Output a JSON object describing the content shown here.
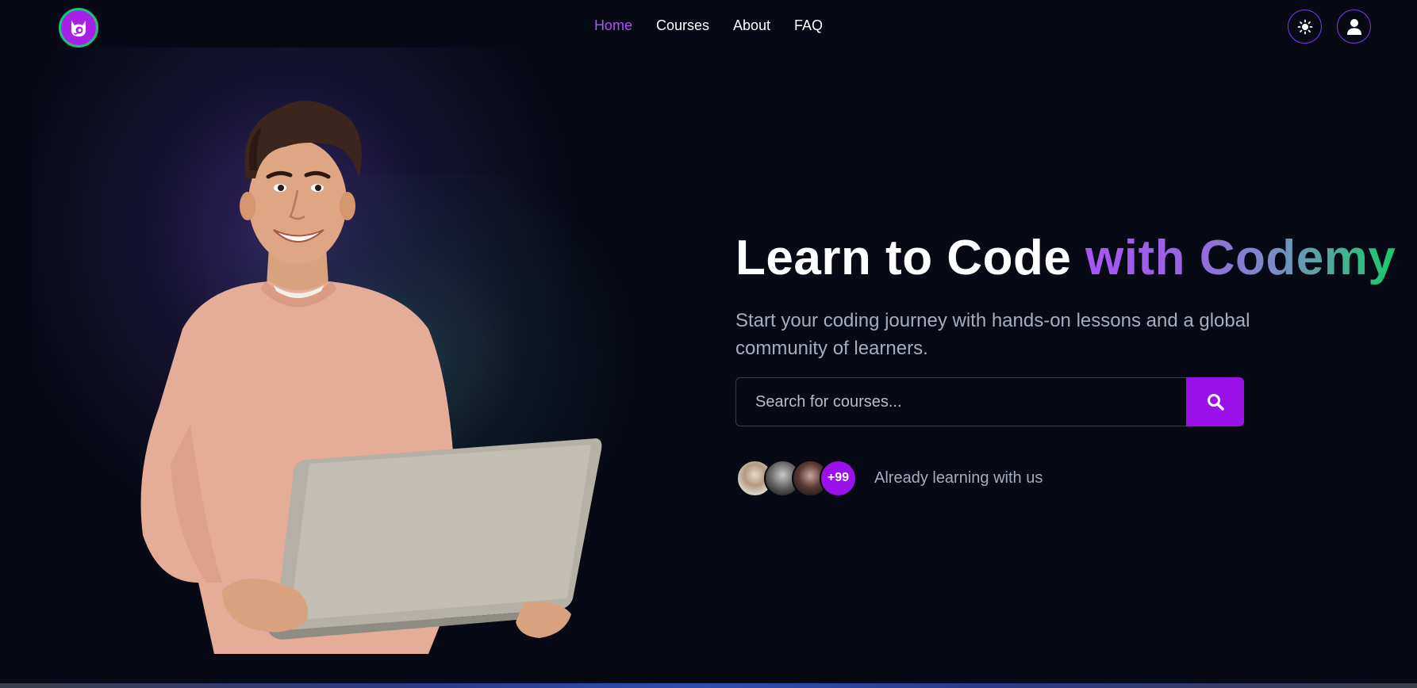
{
  "nav": {
    "links": [
      {
        "label": "Home",
        "active": true
      },
      {
        "label": "Courses",
        "active": false
      },
      {
        "label": "About",
        "active": false
      },
      {
        "label": "FAQ",
        "active": false
      }
    ],
    "theme_toggle_icon": "sun-icon",
    "user_icon": "user-icon",
    "logo_icon": "cat-logo-icon"
  },
  "hero": {
    "title_plain": "Learn to Code",
    "title_accent": "with Codemy",
    "subtitle": "Start your coding journey with hands-on lessons and a global community of learners.",
    "search": {
      "placeholder": "Search for courses...",
      "value": ""
    },
    "social_proof": {
      "count_label": "+99",
      "label": "Already learning with us"
    },
    "image_subject": "smiling young man in peach sweater holding laptop"
  },
  "colors": {
    "accent": "#9b11ea",
    "active_link": "#a855f7",
    "background": "#070914",
    "gradient_end": "#19c96a",
    "logo_ring": "#19c37d",
    "muted_text": "#a6adbb"
  }
}
